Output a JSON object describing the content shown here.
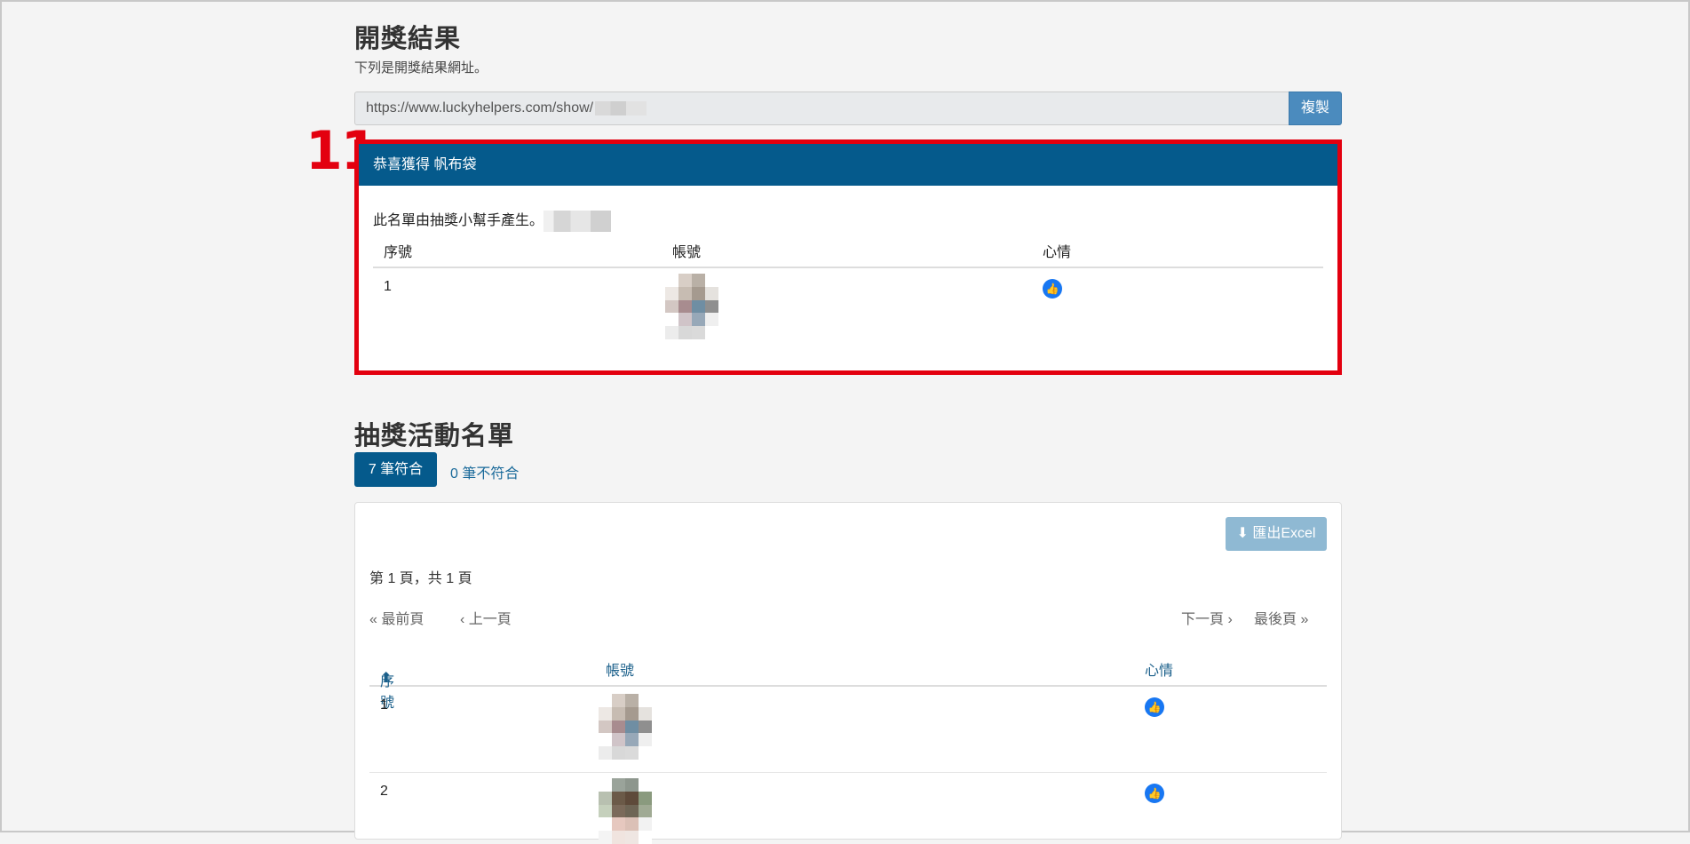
{
  "result": {
    "title": "開獎結果",
    "description": "下列是開獎結果網址。",
    "url": "https://www.luckyhelpers.com/show/",
    "copy_label": "複製"
  },
  "annotation_number": "11",
  "winner": {
    "header": "恭喜獲得 帆布袋",
    "note": "此名單由抽獎小幫手產生。",
    "columns": [
      "序號",
      "帳號",
      "心情"
    ],
    "rows": [
      {
        "index": "1",
        "mood": "like"
      }
    ]
  },
  "list": {
    "title": "抽獎活動名單",
    "tab_match": "7 筆符合",
    "tab_nomatch": "0 筆不符合",
    "export_label": "匯出Excel",
    "page_info": "第 1 頁，共 1 頁",
    "pager": {
      "first": "最前頁",
      "prev": "上一頁",
      "next": "下一頁",
      "last": "最後頁"
    },
    "columns": [
      "序號",
      "帳號",
      "心情"
    ],
    "rows": [
      {
        "index": "1",
        "mood": "like"
      },
      {
        "index": "2",
        "mood": "like"
      }
    ]
  },
  "colors": {
    "primary": "#055a8c",
    "highlight": "#e3000f",
    "like": "#1877f2"
  },
  "icons": [
    "like-icon",
    "sort-icon",
    "download-icon",
    "double-chevron-left-icon",
    "chevron-left-icon",
    "chevron-right-icon",
    "double-chevron-right-icon"
  ]
}
